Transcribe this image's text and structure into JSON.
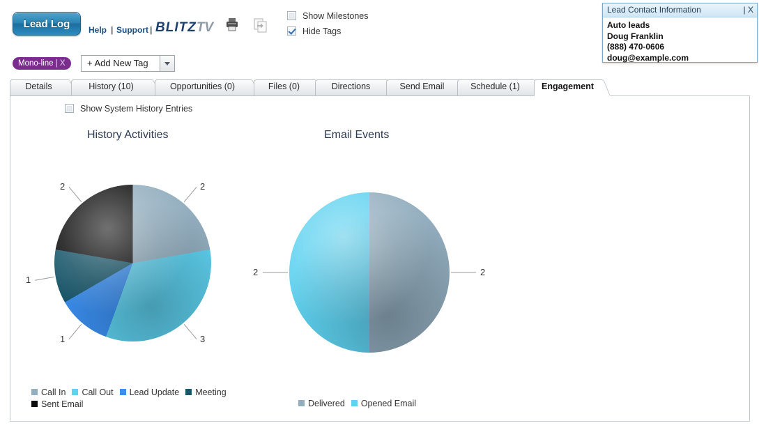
{
  "toolbar": {
    "lead_log_label": "Lead Log",
    "help_label": "Help",
    "separator": "|",
    "support_label": "Support",
    "logo_main": "BLITZ",
    "logo_suffix": "TV",
    "print_icon": "print-icon",
    "copy_icon": "copy-document-icon",
    "checkboxes": [
      {
        "label": "Show Milestones",
        "checked": false
      },
      {
        "label": "Hide Tags",
        "checked": true
      }
    ]
  },
  "tags": {
    "chip_label": "Mono-line",
    "chip_sep": "|",
    "chip_close": "X",
    "add_tag_label": "+ Add New Tag",
    "dropdown_icon": "chevron-down-icon"
  },
  "contact_card": {
    "title": "Lead Contact Information",
    "close_label": "| X",
    "lines": [
      "Auto leads",
      "Doug Franklin",
      "(888) 470-0606",
      "doug@example.com"
    ]
  },
  "tabs": [
    {
      "label": "Details",
      "active": false
    },
    {
      "label": "History (10)",
      "active": false
    },
    {
      "label": "Opportunities (0)",
      "active": false
    },
    {
      "label": "Files (0)",
      "active": false
    },
    {
      "label": "Directions",
      "active": false
    },
    {
      "label": "Send Email",
      "active": false
    },
    {
      "label": "Schedule (1)",
      "active": false
    },
    {
      "label": "Engagement",
      "active": true
    }
  ],
  "panel": {
    "system_history_checkbox": {
      "label": "Show System History Entries",
      "checked": false
    }
  },
  "chart_data": [
    {
      "type": "pie",
      "title": "History Activities",
      "categories": [
        "Call In",
        "Call Out",
        "Lead Update",
        "Meeting",
        "Sent Email"
      ],
      "values": [
        2,
        3,
        1,
        1,
        2
      ],
      "colors": [
        "#93aebf",
        "#5fd2f0",
        "#3b8ff0",
        "#18576b",
        "#0c0c0c"
      ],
      "data_labels": [
        "2",
        "3",
        "1",
        "1",
        "2"
      ],
      "total": 9,
      "legend_position": "bottom"
    },
    {
      "type": "pie",
      "title": "Email Events",
      "categories": [
        "Delivered",
        "Opened Email"
      ],
      "values": [
        2,
        2
      ],
      "colors": [
        "#93aebf",
        "#5fd2f0"
      ],
      "data_labels": [
        "2",
        "2"
      ],
      "total": 4,
      "legend_position": "bottom"
    }
  ]
}
